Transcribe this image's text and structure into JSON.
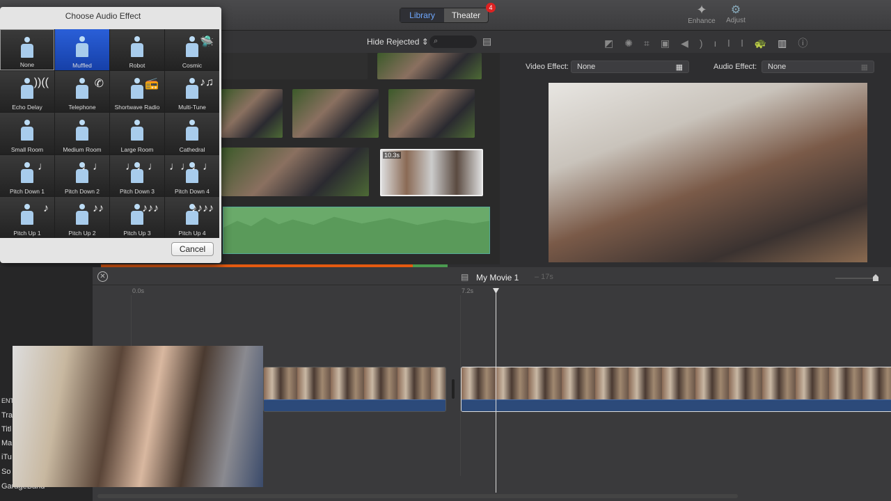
{
  "toolbar": {
    "library": "Library",
    "theater": "Theater",
    "theater_badge": "4",
    "enhance": "Enhance",
    "adjust": "Adjust"
  },
  "browser": {
    "filter": "Hide Rejected",
    "search_placeholder": "",
    "clip_duration": "10.3s"
  },
  "viewer": {
    "video_effect_label": "Video Effect:",
    "video_effect_value": "None",
    "audio_effect_label": "Audio Effect:",
    "audio_effect_value": "None"
  },
  "dialog": {
    "title": "Choose Audio Effect",
    "selected": "Muffled",
    "cancel": "Cancel",
    "effects": [
      {
        "label": "None",
        "icon": ""
      },
      {
        "label": "Muffled",
        "icon": ""
      },
      {
        "label": "Robot",
        "icon": ""
      },
      {
        "label": "Cosmic",
        "icon": "🛸"
      },
      {
        "label": "Echo Delay",
        "icon": "))(("
      },
      {
        "label": "Telephone",
        "icon": "✆"
      },
      {
        "label": "Shortwave Radio",
        "icon": "📻"
      },
      {
        "label": "Multi-Tune",
        "icon": "♪♫"
      },
      {
        "label": "Small Room",
        "icon": ""
      },
      {
        "label": "Medium Room",
        "icon": ""
      },
      {
        "label": "Large Room",
        "icon": ""
      },
      {
        "label": "Cathedral",
        "icon": ""
      },
      {
        "label": "Pitch Down 1",
        "icon": "♩"
      },
      {
        "label": "Pitch Down 2",
        "icon": "♩♩"
      },
      {
        "label": "Pitch Down 3",
        "icon": "♩♩♩"
      },
      {
        "label": "Pitch Down 4",
        "icon": "♩♩♩♩"
      },
      {
        "label": "Pitch Up 1",
        "icon": "♪"
      },
      {
        "label": "Pitch Up 2",
        "icon": "♪♪"
      },
      {
        "label": "Pitch Up 3",
        "icon": "♪♪♪"
      },
      {
        "label": "Pitch Up 4",
        "icon": "♪♪♪♪"
      }
    ]
  },
  "timeline": {
    "title": "My Movie 1",
    "duration": "– 17s",
    "tick_start": "0.0s",
    "tick_mid": "7.2s"
  },
  "sidebar": {
    "items": [
      "ENT",
      "Tra",
      "Titl",
      "Ma",
      "iTu",
      "So",
      "GarageBand"
    ]
  }
}
